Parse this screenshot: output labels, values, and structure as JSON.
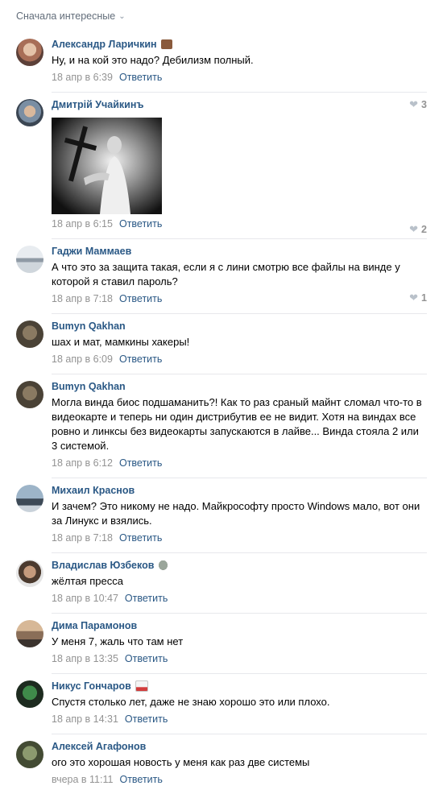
{
  "sort": {
    "label": "Сначала интересные"
  },
  "comments": [
    {
      "author": "Александр Ларичкин",
      "text": "Ну, и на кой это надо? Дебилизм полный.",
      "date": "18 апр в 6:39",
      "reply": "Ответить",
      "likes": "3"
    },
    {
      "author": "Дмитрій Учайкинъ",
      "text": "",
      "date": "18 апр в 6:15",
      "reply": "Ответить",
      "likes": "2"
    },
    {
      "author": "Гаджи Маммаев",
      "text": "А что это за защита такая, если я с лини смотрю все файлы на винде у которой я ставил пароль?",
      "date": "18 апр в 7:18",
      "reply": "Ответить",
      "likes": "1"
    },
    {
      "author": "Bumyn Qakhan",
      "text": "шах и мат, мамкины хакеры!",
      "date": "18 апр в 6:09",
      "reply": "Ответить",
      "likes": ""
    },
    {
      "author": "Bumyn Qakhan",
      "text": "Могла винда биос подшаманить?! Как то раз сраный майнт сломал что-то в видеокарте и теперь ни один дистрибутив ее не видит. Хотя на виндах все ровно и линксы без видеокарты запускаются в лайве... Винда стояла 2 или 3 системой.",
      "date": "18 апр в 6:12",
      "reply": "Ответить",
      "likes": ""
    },
    {
      "author": "Михаил Краснов",
      "text": "И зачем? Это никому не надо. Майкрософту просто Windows мало, вот они за Линукс и взялись.",
      "date": "18 апр в 7:18",
      "reply": "Ответить",
      "likes": ""
    },
    {
      "author": "Владислав Юзбеков",
      "text": "жёлтая пресса",
      "date": "18 апр в 10:47",
      "reply": "Ответить",
      "likes": ""
    },
    {
      "author": "Дима Парамонов",
      "text": "У меня 7, жаль что там нет",
      "date": "18 апр в 13:35",
      "reply": "Ответить",
      "likes": ""
    },
    {
      "author": "Никус Гончаров",
      "text": "Спустя столько лет, даже не знаю хорошо это или плохо.",
      "date": "18 апр в 14:31",
      "reply": "Ответить",
      "likes": ""
    },
    {
      "author": "Алексей Агафонов",
      "text": "ого это хорошая новость у меня как раз две системы",
      "date": "вчера в 11:11",
      "reply": "Ответить",
      "likes": ""
    }
  ],
  "colors": {
    "author": "#2a5885",
    "meta": "#939393",
    "divider": "#e7e8ec"
  }
}
